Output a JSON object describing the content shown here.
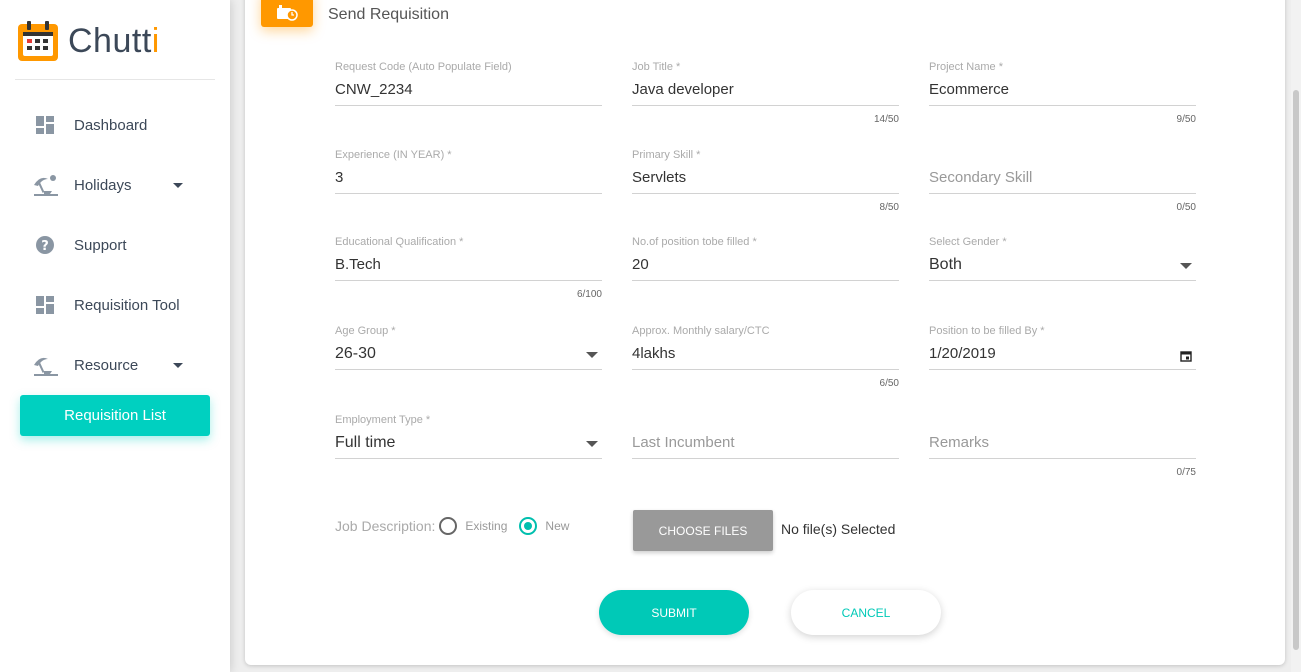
{
  "app": {
    "logo_main": "Chutt",
    "logo_accent": "i"
  },
  "sidebar": {
    "items": [
      {
        "label": "Dashboard",
        "icon": "dashboard-icon"
      },
      {
        "label": "Holidays",
        "icon": "beach-icon",
        "has_submenu": true
      },
      {
        "label": "Support",
        "icon": "help-icon"
      },
      {
        "label": "Requisition Tool",
        "icon": "dashboard-icon"
      },
      {
        "label": "Resource",
        "icon": "beach-icon",
        "has_submenu": true
      }
    ],
    "active_item": "Requisition List"
  },
  "page": {
    "title": "Send Requisition"
  },
  "form": {
    "request_code": {
      "label": "Request Code (Auto Populate Field)",
      "value": "CNW_2234"
    },
    "job_title": {
      "label": "Job Title *",
      "value": "Java developer",
      "counter": "14/50"
    },
    "project_name": {
      "label": "Project Name *",
      "value": "Ecommerce",
      "counter": "9/50"
    },
    "experience": {
      "label": "Experience (IN YEAR) *",
      "value": "3"
    },
    "primary_skill": {
      "label": "Primary Skill *",
      "value": "Servlets",
      "counter": "8/50"
    },
    "secondary_skill": {
      "placeholder": "Secondary Skill",
      "counter": "0/50"
    },
    "education": {
      "label": "Educational Qualification *",
      "value": "B.Tech",
      "counter": "6/100"
    },
    "positions": {
      "label": "No.of position tobe filled *",
      "value": "20"
    },
    "gender": {
      "label": "Select Gender *",
      "value": "Both"
    },
    "age_group": {
      "label": "Age Group *",
      "value": "26-30"
    },
    "salary": {
      "label": "Approx. Monthly salary/CTC",
      "value": "4lakhs",
      "counter": "6/50"
    },
    "filled_by": {
      "label": "Position to be filled By *",
      "value": "1/20/2019"
    },
    "employment_type": {
      "label": "Employment Type *",
      "value": "Full time"
    },
    "last_incumbent": {
      "placeholder": "Last Incumbent"
    },
    "remarks": {
      "placeholder": "Remarks",
      "counter": "0/75"
    },
    "job_description": {
      "label": "Job Description:",
      "options": [
        "Existing",
        "New"
      ],
      "selected": "New"
    },
    "file": {
      "button": "CHOOSE FILES",
      "status": "No file(s) Selected"
    },
    "submit_label": "SUBMIT",
    "cancel_label": "CANCEL"
  },
  "colors": {
    "accent": "#00c9b7",
    "brand": "#ff9800"
  }
}
